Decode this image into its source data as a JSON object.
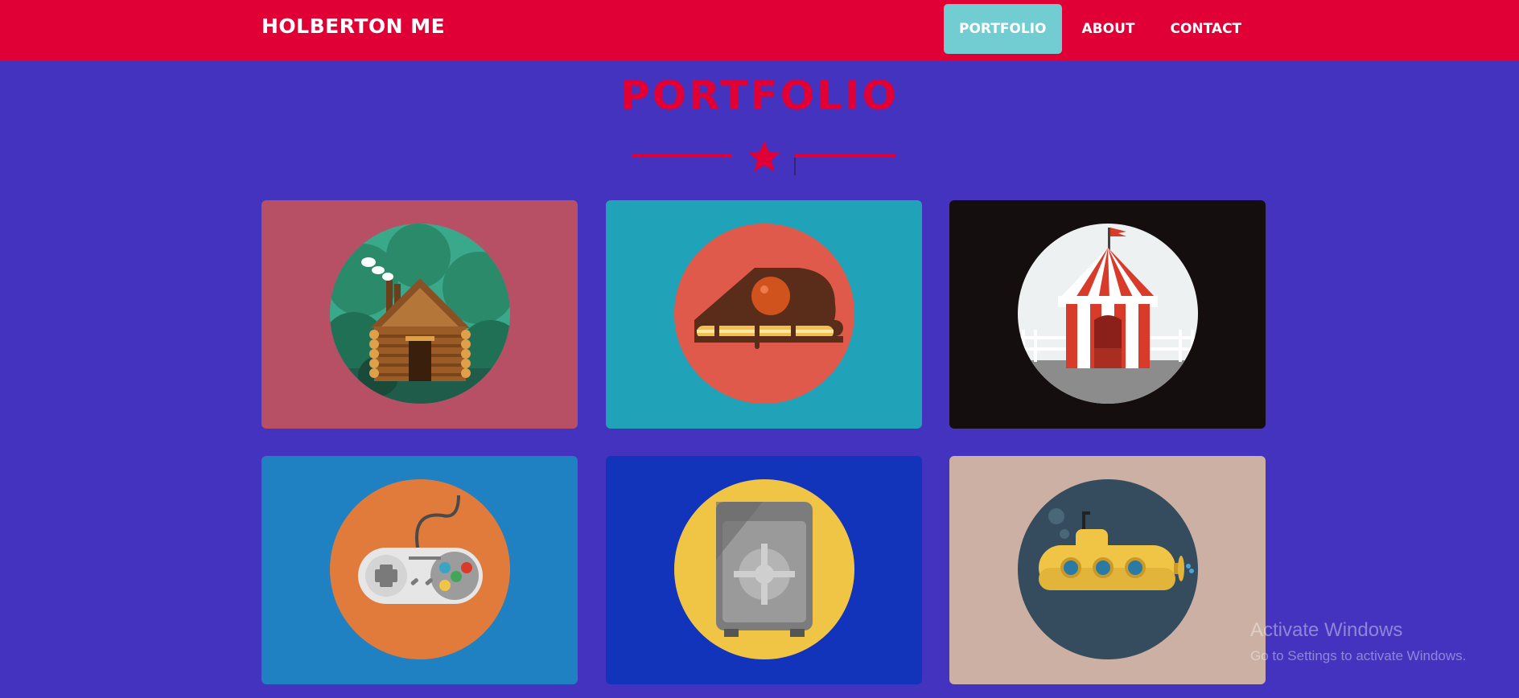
{
  "navbar": {
    "brand": "HOLBERTON ME",
    "links": [
      {
        "label": "PORTFOLIO",
        "active": true
      },
      {
        "label": "ABOUT",
        "active": false
      },
      {
        "label": "CONTACT",
        "active": false
      }
    ]
  },
  "portfolio": {
    "title": "PORTFOLIO",
    "divider_icon": "star-icon",
    "items": [
      {
        "icon": "cabin-icon",
        "bg": "#b85065",
        "circle": "#3aa88a"
      },
      {
        "icon": "cake-icon",
        "bg": "#20a2b8",
        "circle": "#e05a4b"
      },
      {
        "icon": "circus-tent-icon",
        "bg": "#140e0f",
        "circle": "#eef1f1"
      },
      {
        "icon": "game-controller-icon",
        "bg": "#1f81c2",
        "circle": "#e07b3b"
      },
      {
        "icon": "safe-icon",
        "bg": "#1234ba",
        "circle": "#f0c445"
      },
      {
        "icon": "submarine-icon",
        "bg": "#cbb0a3",
        "circle": "#344c5d"
      }
    ]
  },
  "colors": {
    "accent": "#e00036",
    "page_bg": "#4433bf",
    "active_link_bg": "#72cdd2"
  },
  "watermark": {
    "title": "Activate Windows",
    "subtitle": "Go to Settings to activate Windows."
  }
}
